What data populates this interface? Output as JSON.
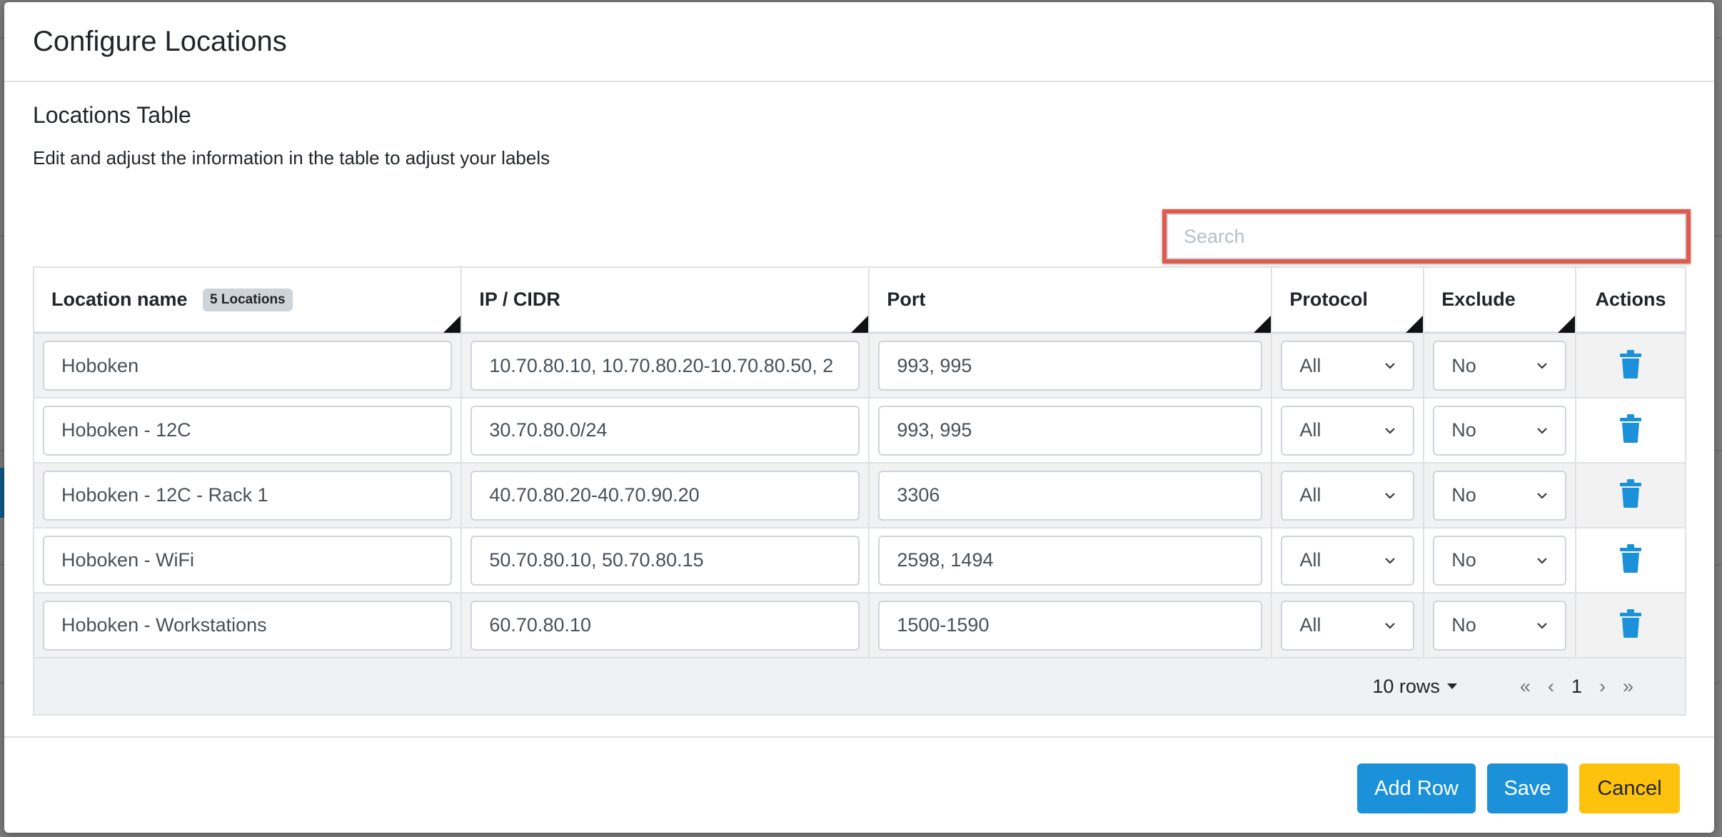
{
  "modal": {
    "title": "Configure Locations",
    "section_title": "Locations Table",
    "description": "Edit and adjust the information in the table to adjust your labels"
  },
  "search": {
    "placeholder": "Search",
    "value": ""
  },
  "table": {
    "headers": {
      "location": "Location name",
      "locations_badge": "5 Locations",
      "ip": "IP / CIDR",
      "port": "Port",
      "protocol": "Protocol",
      "exclude": "Exclude",
      "actions": "Actions"
    },
    "rows": [
      {
        "name": "Hoboken",
        "ip": "10.70.80.10, 10.70.80.20-10.70.80.50, 2",
        "port": "993, 995",
        "protocol": "All",
        "exclude": "No"
      },
      {
        "name": "Hoboken - 12C",
        "ip": "30.70.80.0/24",
        "port": "993, 995",
        "protocol": "All",
        "exclude": "No"
      },
      {
        "name": "Hoboken - 12C - Rack 1",
        "ip": "40.70.80.20-40.70.90.20",
        "port": "3306",
        "protocol": "All",
        "exclude": "No"
      },
      {
        "name": "Hoboken - WiFi",
        "ip": "50.70.80.10, 50.70.80.15",
        "port": "2598, 1494",
        "protocol": "All",
        "exclude": "No"
      },
      {
        "name": "Hoboken - Workstations",
        "ip": "60.70.80.10",
        "port": "1500-1590",
        "protocol": "All",
        "exclude": "No"
      }
    ],
    "row_icon": "trash-icon"
  },
  "pagination": {
    "rows_label": "10 rows",
    "first": "«",
    "prev": "‹",
    "current_page": "1",
    "next": "›",
    "last": "»"
  },
  "footer": {
    "add_row": "Add Row",
    "save": "Save",
    "cancel": "Cancel"
  },
  "colors": {
    "primary": "#1b91d9",
    "warning": "#fcc20d",
    "highlight": "#e05a4f"
  }
}
